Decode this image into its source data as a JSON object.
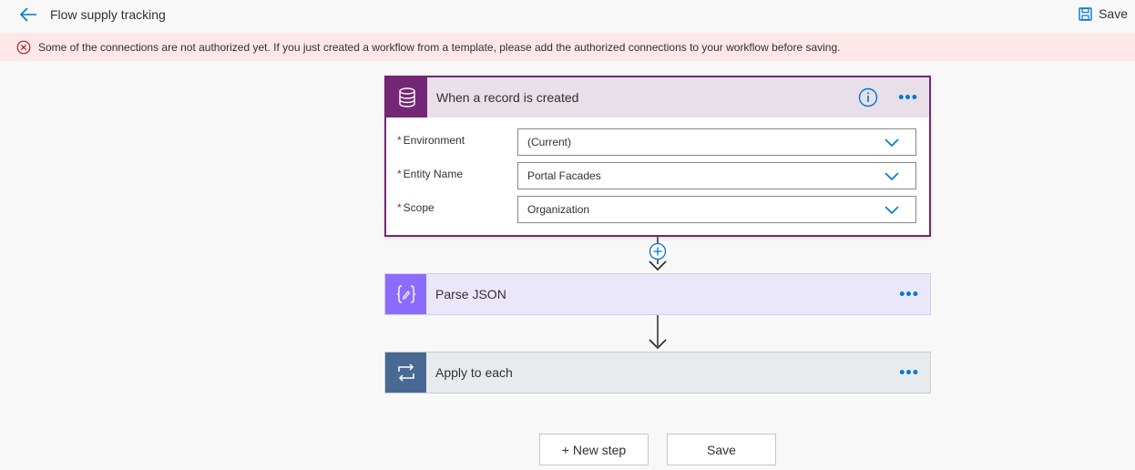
{
  "header": {
    "title": "Flow supply tracking",
    "save_label": "Save"
  },
  "banner": {
    "message": "Some of the connections are not authorized yet. If you just created a workflow from a template, please add the authorized connections to your workflow before saving."
  },
  "trigger": {
    "title": "When a record is created",
    "icon": "database-icon",
    "accent": "#742774",
    "fields": [
      {
        "label": "Environment",
        "value": "(Current)"
      },
      {
        "label": "Entity Name",
        "value": "Portal Facades"
      },
      {
        "label": "Scope",
        "value": "Organization"
      }
    ]
  },
  "steps": [
    {
      "title": "Parse JSON",
      "icon": "json-braces-icon",
      "accent": "#8c6cff"
    },
    {
      "title": "Apply to each",
      "icon": "loop-icon",
      "accent": "#486991"
    }
  ],
  "footer": {
    "new_step_label": "+ New step",
    "save_label": "Save"
  },
  "colors": {
    "brand_blue": "#0078d4",
    "error_bg": "#fde7e9",
    "error_icon": "#a4262c"
  }
}
